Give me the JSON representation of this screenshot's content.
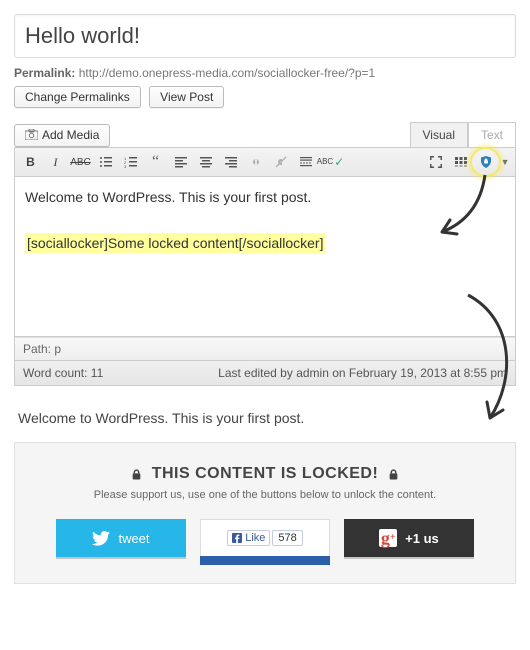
{
  "title": "Hello world!",
  "permalink": {
    "label": "Permalink:",
    "url": "http://demo.onepress-media.com/sociallocker-free/?p=1"
  },
  "buttons": {
    "change_permalinks": "Change Permalinks",
    "view_post": "View Post",
    "add_media": "Add Media"
  },
  "tabs": {
    "visual": "Visual",
    "text": "Text"
  },
  "toolbar": {
    "bold": "B",
    "italic": "I",
    "strike": "ABC",
    "spell": "ABC"
  },
  "editor": {
    "line1": "Welcome to WordPress. This is your first post.",
    "highlight": "[sociallocker]Some locked content[/sociallocker]"
  },
  "pathbar": "Path: p",
  "status": {
    "wordcount": "Word count: 11",
    "lastedit": "Last edited by admin on February 19, 2013 at 8:55 pm"
  },
  "preview_text": "Welcome to WordPress. This is your first post.",
  "locker": {
    "title": "THIS CONTENT IS LOCKED!",
    "subtitle": "Please support us, use one of the buttons below to unlock the content.",
    "tweet": "tweet",
    "like": "Like",
    "like_count": "578",
    "gplus": "+1 us"
  }
}
